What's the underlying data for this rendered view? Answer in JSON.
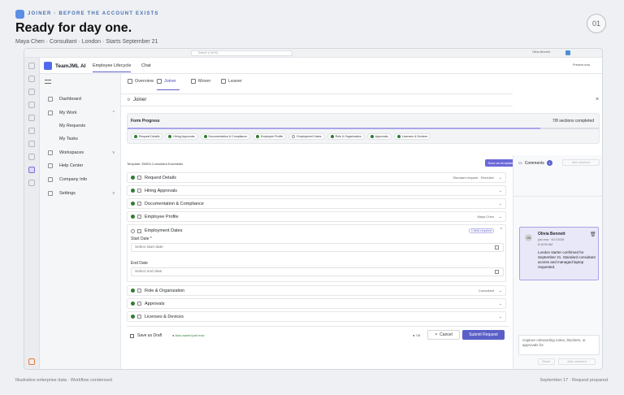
{
  "header": {
    "kicker": "JOINER · BEFORE THE ACCOUNT EXISTS",
    "title": "Ready for day one.",
    "subtitle": "Maya Chen · Consultant · London · Starts September 21",
    "step": "01"
  },
  "footer": {
    "left": "Illustrative enterprise data · Workflow condensed",
    "right": "September 17 · Request prepared"
  },
  "window": {
    "search_placeholder": "Search (Ctrl+E)",
    "user_name": "Olivia Bennett",
    "present_label": "Present now"
  },
  "app": {
    "name": "TeamJML AI",
    "tabs": [
      "Employee Lifecycle",
      "Chat"
    ]
  },
  "sidebar": {
    "items": [
      {
        "label": "Dashboard"
      },
      {
        "label": "My Work"
      },
      {
        "label": "My Requests"
      },
      {
        "label": "My Tasks"
      },
      {
        "label": "Workspaces"
      },
      {
        "label": "Help Center"
      },
      {
        "label": "Company Info"
      },
      {
        "label": "Settings"
      }
    ]
  },
  "page": {
    "tabs": [
      "Overview",
      "Joiner",
      "Mover",
      "Leaver"
    ],
    "panel_title": "Joiner",
    "form_progress_label": "Form Progress",
    "progress_text": "7/8 sections completed",
    "progress_fraction": 0.875,
    "chips": [
      {
        "label": "Request Details",
        "done": true
      },
      {
        "label": "Hiring Approvals",
        "done": true
      },
      {
        "label": "Documentation & Compliance",
        "done": true
      },
      {
        "label": "Employee Profile",
        "done": true
      },
      {
        "label": "Employment Dates",
        "done": false
      },
      {
        "label": "Role & Organization",
        "done": true
      },
      {
        "label": "Approvals",
        "done": true
      },
      {
        "label": "Licenses & Devices",
        "done": true
      }
    ],
    "template_label": "Template: EMEA Consultant Essentials",
    "save_template": "Save as template",
    "sections": [
      {
        "title": "Request Details",
        "meta": "Standard request · Recruiter"
      },
      {
        "title": "Hiring Approvals",
        "meta": ""
      },
      {
        "title": "Documentation & Compliance",
        "meta": ""
      },
      {
        "title": "Employee Profile",
        "meta": "Maya Chen"
      },
      {
        "title": "Employment Dates",
        "meta": "1 field required"
      },
      {
        "title": "Role & Organization",
        "meta": "Consultant"
      },
      {
        "title": "Approvals",
        "meta": ""
      },
      {
        "title": "Licenses & Devices",
        "meta": ""
      }
    ],
    "start_date_label": "Start Date *",
    "start_date_placeholder": "Select start date",
    "end_date_label": "End Date",
    "end_date_placeholder": "Select end date",
    "save_draft": "Save as Draft",
    "autosaved": "Auto-saved just now",
    "count": "7/8",
    "cancel": "Cancel",
    "submit": "Submit Request"
  },
  "comments": {
    "title": "Comments",
    "count": "1",
    "add": "Add comment",
    "author": "Olivia Bennett",
    "initials": "OB",
    "time": "just now · 9/17/2026",
    "time2": "8:10:00 AM",
    "body": "London starter confirmed for September 21. Standard consultant access and managed laptop requested.",
    "input_placeholder": "Capture onboarding notes, blockers, or approvals for",
    "reset": "Reset",
    "add2": "Add comment"
  },
  "colors": {
    "accent": "#5b5fc7",
    "done": "#2e7d32"
  }
}
